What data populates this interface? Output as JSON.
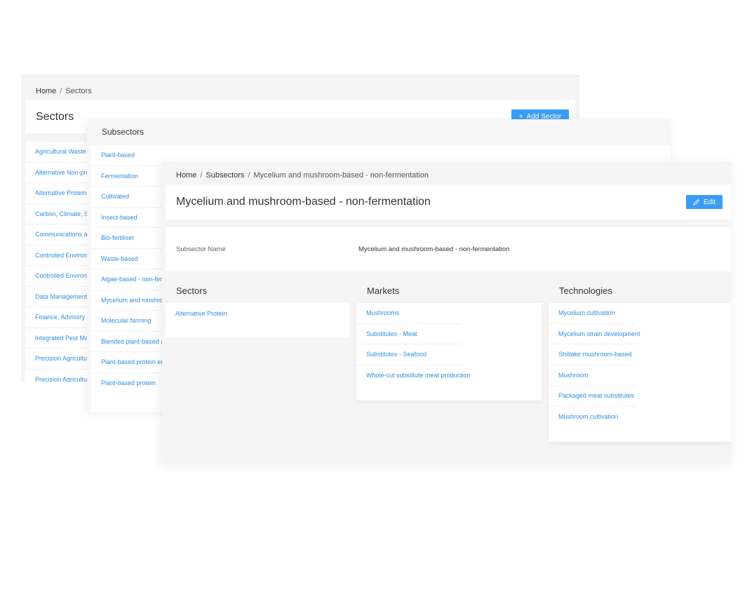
{
  "sectors_page": {
    "breadcrumb": {
      "home": "Home",
      "current": "Sectors"
    },
    "title": "Sectors",
    "add_button": "Add Sector",
    "items": [
      "Agricultural Waste Ma",
      "Alternative Non-pro",
      "Alternative Protein",
      "Carbon, Climate, So",
      "Communications an",
      "Controlled Environm",
      "Controlled Environm",
      "Data Management",
      "Finance, Advisory an",
      "Integrated Pest Man",
      "Precision Agricultur",
      "Precision Agricultur"
    ]
  },
  "subsectors_page": {
    "title": "Subsectors",
    "items": [
      "Plant-based",
      "Fermentation",
      "Cultivated",
      "Insect-based",
      "Bio-fertiliser",
      "Waste-based",
      "Algae-based - non-ferm",
      "Mycelium and mushro",
      "Molecular farming",
      "Blended plant-based a",
      "Plant-based protein en",
      "Plant-based protein"
    ]
  },
  "detail_page": {
    "breadcrumb": {
      "home": "Home",
      "parent": "Subsectors",
      "current": "Mycelium and mushroom-based - non-fermentation"
    },
    "title": "Mycelium and mushroom-based - non-fermentation",
    "edit_button": "Edit",
    "field_label": "Subsector Name",
    "field_value": "Mycelium and mushroom-based - non-fermentation",
    "sectors": {
      "title": "Sectors",
      "items": [
        "Alternative Protein"
      ]
    },
    "markets": {
      "title": "Markets",
      "items": [
        "Mushrooms",
        "Substitutes - Meat",
        "Substitutes - Seafood",
        "Whole-cut substitute meat production"
      ]
    },
    "technologies": {
      "title": "Technologies",
      "items": [
        "Mycelium cultivation",
        "Mycelium strain development",
        "Shiitake mushroom-based",
        "Mushroom",
        "Packaged meat substitutes",
        "Mushroom cultivation"
      ]
    }
  },
  "colors": {
    "accent": "#3a9df3",
    "link": "#2e8fe0",
    "panel_bg": "#f5f5f5"
  }
}
